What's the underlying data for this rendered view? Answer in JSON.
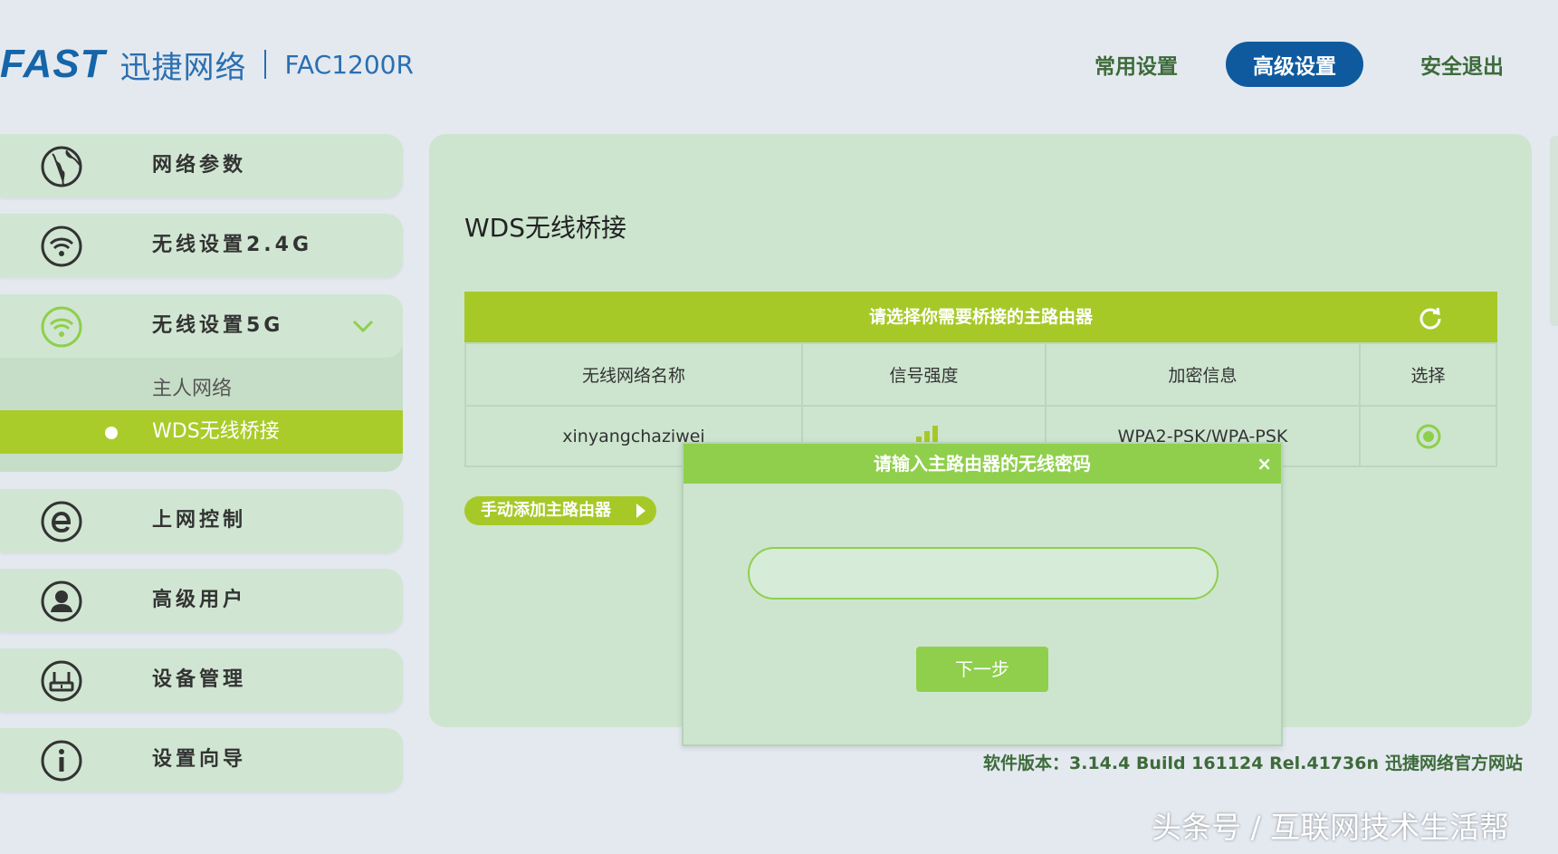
{
  "header": {
    "brand_logo": "FAST",
    "brand_name": "迅捷网络",
    "model": "FAC1200R",
    "nav": [
      {
        "label": "常用设置",
        "active": false
      },
      {
        "label": "高级设置",
        "active": true
      },
      {
        "label": "安全退出",
        "active": false
      }
    ]
  },
  "sidebar": {
    "items": [
      {
        "label": "网络参数",
        "icon": "globe-icon"
      },
      {
        "label": "无线设置2.4G",
        "icon": "wifi-icon"
      },
      {
        "label": "无线设置5G",
        "icon": "wifi-icon",
        "expanded": true
      },
      {
        "label": "上网控制",
        "icon": "ie-icon"
      },
      {
        "label": "高级用户",
        "icon": "user-icon"
      },
      {
        "label": "设备管理",
        "icon": "router-icon"
      },
      {
        "label": "设置向导",
        "icon": "info-icon"
      }
    ],
    "submenu": [
      {
        "label": "主人网络",
        "active": false
      },
      {
        "label": "WDS无线桥接",
        "active": true
      }
    ]
  },
  "main": {
    "title": "WDS无线桥接",
    "table": {
      "header": "请选择你需要桥接的主路由器",
      "columns": [
        "无线网络名称",
        "信号强度",
        "加密信息",
        "选择"
      ],
      "rows": [
        {
          "ssid": "xinyangchaziwei",
          "encryption": "WPA2-PSK/WPA-PSK"
        }
      ]
    },
    "manual_add_label": "手动添加主路由器"
  },
  "modal": {
    "title": "请输入主路由器的无线密码",
    "close": "×",
    "password_value": "",
    "next_label": "下一步"
  },
  "footer": {
    "version": "软件版本：3.14.4 Build 161124 Rel.41736n",
    "official_link": "迅捷网络官方网站"
  },
  "watermark": "头条号 / 互联网技术生活帮",
  "colors": {
    "accent_green": "#a6c928",
    "modal_green": "#8fcf4c",
    "brand_blue": "#0f5a9e"
  }
}
